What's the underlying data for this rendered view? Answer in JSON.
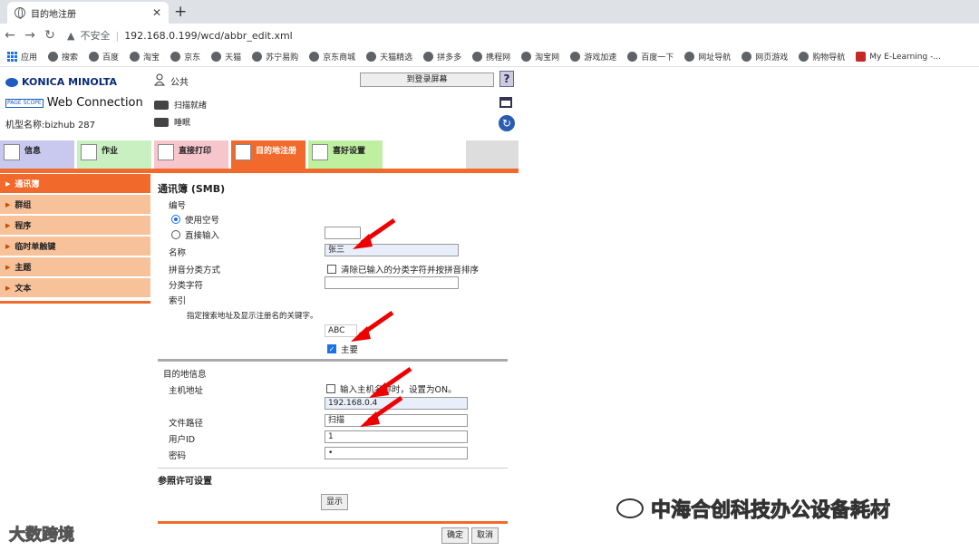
{
  "browser": {
    "tab_title": "目的地注册",
    "tab_close": "✕",
    "new_tab": "+",
    "insecure_label": "不安全",
    "url": "192.168.0.199/wcd/abbr_edit.xml",
    "bookmarks": [
      "应用",
      "搜索",
      "百度",
      "淘宝",
      "京东",
      "天猫",
      "苏宁易购",
      "京东商城",
      "天猫精选",
      "拼多多",
      "携程网",
      "淘宝网",
      "游戏加速",
      "百度一下",
      "网址导航",
      "网页游戏",
      "购物导航",
      "My E-Learning -..."
    ]
  },
  "brand": {
    "maker": "KONICA MINOLTA",
    "product": "Web Connection",
    "ps_mark": "PAGE SCOPE",
    "model": "机型名称:bizhub 287"
  },
  "header": {
    "user": "公共",
    "logout": "到登录屏幕",
    "help": "?",
    "status_scan": "扫描就绪",
    "status_print": "睡眠"
  },
  "menu_tabs": [
    "信息",
    "作业",
    "直接打印",
    "目的地注册",
    "喜好设置"
  ],
  "sidebar": [
    "通讯簿",
    "群组",
    "程序",
    "临时单触键",
    "主题",
    "文本"
  ],
  "form": {
    "title": "通讯簿 (SMB)",
    "number_label": "编号",
    "use_free_number": "使用空号",
    "direct_input": "直接输入",
    "name_label": "名称",
    "name_value": "张三",
    "pinyin_label": "拼音分类方式",
    "pinyin_option": "清除已输入的分类字符并按拼音排序",
    "sort_char_label": "分类字符",
    "index_label": "索引",
    "index_hint": "指定搜索地址及显示注册名的关键字。",
    "index_value": "ABC",
    "main_label": "主要",
    "dest_info": "目的地信息",
    "host_label": "主机地址",
    "host_option": "输入主机名称时，设置为ON。",
    "host_value": "192.168.0.4",
    "path_label": "文件路径",
    "path_value": "扫描",
    "userid_label": "用户ID",
    "userid_value": "1",
    "password_label": "密码",
    "password_value": "•",
    "ref_perm": "参照许可设置",
    "show_btn": "显示",
    "ok_btn": "确定",
    "cancel_btn": "取消"
  },
  "watermark": {
    "right": "中海合创科技办公设备耗材",
    "left": "大数跨境"
  }
}
